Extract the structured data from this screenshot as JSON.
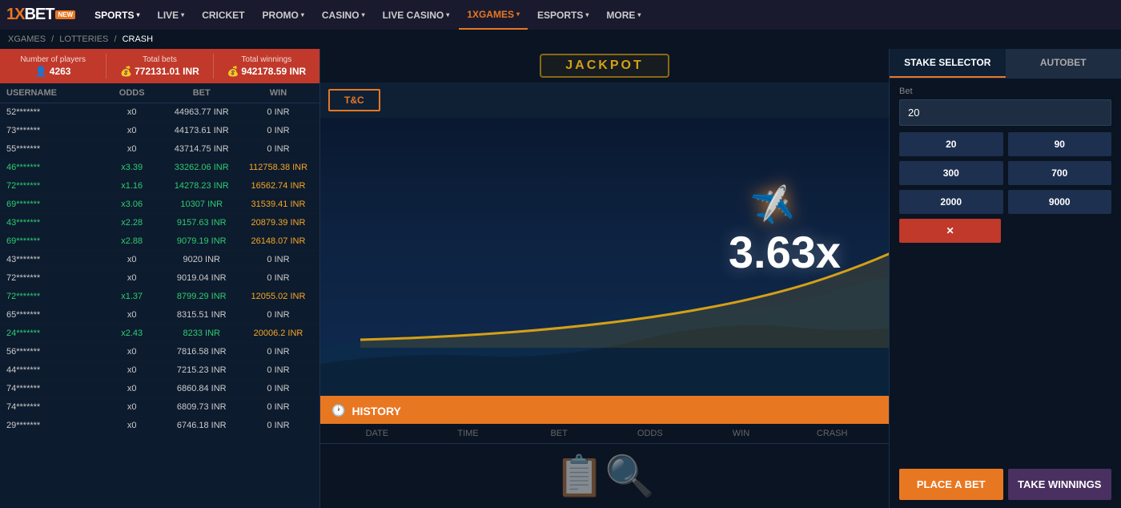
{
  "logo": {
    "brand": "1XBET",
    "new_badge": "NEW"
  },
  "nav": {
    "items": [
      {
        "label": "SPORTS",
        "has_arrow": true,
        "active": false
      },
      {
        "label": "LIVE",
        "has_arrow": true,
        "active": false
      },
      {
        "label": "CRICKET",
        "has_arrow": false,
        "active": false
      },
      {
        "label": "PROMO",
        "has_arrow": true,
        "active": false
      },
      {
        "label": "CASINO",
        "has_arrow": true,
        "active": false
      },
      {
        "label": "LIVE CASINO",
        "has_arrow": true,
        "active": false
      },
      {
        "label": "1XGAMES",
        "has_arrow": true,
        "active": true
      },
      {
        "label": "ESPORTS",
        "has_arrow": true,
        "active": false
      },
      {
        "label": "MORE",
        "has_arrow": true,
        "active": false
      }
    ]
  },
  "breadcrumb": {
    "items": [
      "XGAMES",
      "LOTTERIES",
      "CRASH"
    ]
  },
  "stats": {
    "players_label": "Number of players",
    "players_value": "4263",
    "bets_label": "Total bets",
    "bets_value": "772131.01 INR",
    "winnings_label": "Total winnings",
    "winnings_value": "942178.59 INR"
  },
  "table": {
    "headers": [
      "USERNAME",
      "ODDS",
      "BET",
      "WIN"
    ],
    "rows": [
      {
        "username": "52*******",
        "odds": "x0",
        "bet": "44963.77 INR",
        "win": "0 INR",
        "win_type": "normal"
      },
      {
        "username": "73*******",
        "odds": "x0",
        "bet": "44173.61 INR",
        "win": "0 INR",
        "win_type": "normal"
      },
      {
        "username": "55*******",
        "odds": "x0",
        "bet": "43714.75 INR",
        "win": "0 INR",
        "win_type": "normal"
      },
      {
        "username": "46*******",
        "odds": "x3.39",
        "bet": "33262.06 INR",
        "win": "112758.38 INR",
        "win_type": "win"
      },
      {
        "username": "72*******",
        "odds": "x1.16",
        "bet": "14278.23 INR",
        "win": "16562.74 INR",
        "win_type": "win"
      },
      {
        "username": "69*******",
        "odds": "x3.06",
        "bet": "10307 INR",
        "win": "31539.41 INR",
        "win_type": "win"
      },
      {
        "username": "43*******",
        "odds": "x2.28",
        "bet": "9157.63 INR",
        "win": "20879.39 INR",
        "win_type": "win"
      },
      {
        "username": "69*******",
        "odds": "x2.88",
        "bet": "9079.19 INR",
        "win": "26148.07 INR",
        "win_type": "win"
      },
      {
        "username": "43*******",
        "odds": "x0",
        "bet": "9020 INR",
        "win": "0 INR",
        "win_type": "normal"
      },
      {
        "username": "72*******",
        "odds": "x0",
        "bet": "9019.04 INR",
        "win": "0 INR",
        "win_type": "normal"
      },
      {
        "username": "72*******",
        "odds": "x1.37",
        "bet": "8799.29 INR",
        "win": "12055.02 INR",
        "win_type": "win"
      },
      {
        "username": "65*******",
        "odds": "x0",
        "bet": "8315.51 INR",
        "win": "0 INR",
        "win_type": "normal"
      },
      {
        "username": "24*******",
        "odds": "x2.43",
        "bet": "8233 INR",
        "win": "20006.2 INR",
        "win_type": "win"
      },
      {
        "username": "56*******",
        "odds": "x0",
        "bet": "7816.58 INR",
        "win": "0 INR",
        "win_type": "normal"
      },
      {
        "username": "44*******",
        "odds": "x0",
        "bet": "7215.23 INR",
        "win": "0 INR",
        "win_type": "normal"
      },
      {
        "username": "74*******",
        "odds": "x0",
        "bet": "6860.84 INR",
        "win": "0 INR",
        "win_type": "normal"
      },
      {
        "username": "74*******",
        "odds": "x0",
        "bet": "6809.73 INR",
        "win": "0 INR",
        "win_type": "normal"
      },
      {
        "username": "29*******",
        "odds": "x0",
        "bet": "6746.18 INR",
        "win": "0 INR",
        "win_type": "normal"
      }
    ]
  },
  "jackpot": {
    "text": "JACKPOT"
  },
  "tc_button": "T&C",
  "multiplier": "3.63x",
  "history": {
    "title": "HISTORY",
    "headers": [
      "DATE",
      "TIME",
      "BET",
      "ODDS",
      "WIN",
      "CRASH"
    ],
    "empty_message": "No data"
  },
  "stake_selector": {
    "tab1": "STAKE SELECTOR",
    "tab2": "AUTOBET",
    "bet_label": "Bet",
    "bet_value": "20",
    "quick_amounts": [
      "20",
      "90",
      "300",
      "700",
      "2000",
      "9000"
    ],
    "clear_label": "✕",
    "place_bet": "PLACE A BET",
    "take_winnings": "TAKE WINNINGS"
  }
}
